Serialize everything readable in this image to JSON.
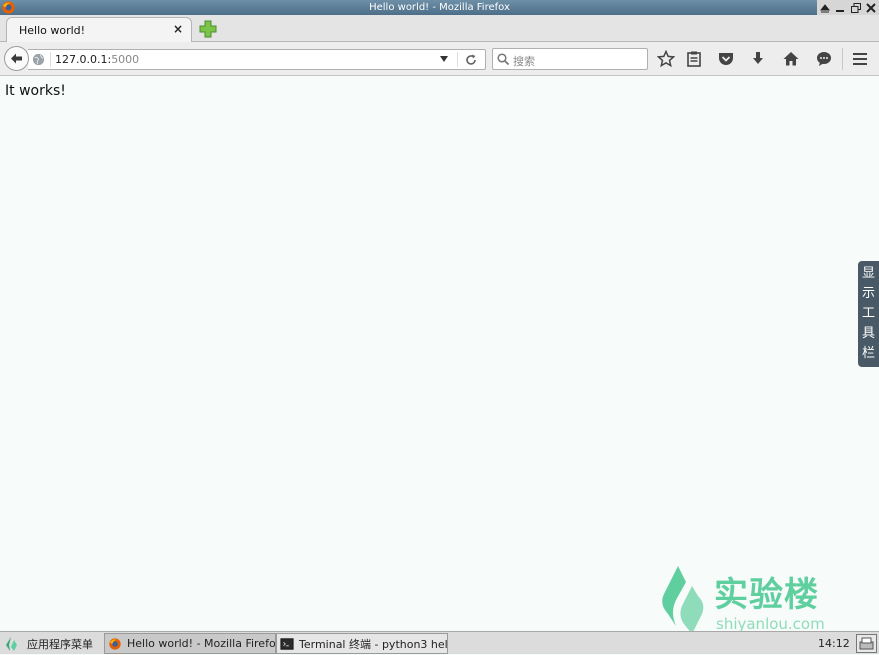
{
  "window": {
    "title": "Hello world! - Mozilla Firefox"
  },
  "tab": {
    "title": "Hello world!",
    "close_glyph": "×"
  },
  "navbar": {
    "url_host": "127.0.0.1:",
    "url_port": "5000",
    "search_placeholder": "搜索"
  },
  "page": {
    "body_text": "It works!"
  },
  "side_toolbar": {
    "chars": [
      "显",
      "示",
      "工",
      "具",
      "栏"
    ]
  },
  "watermark": {
    "text": "实验楼",
    "url": "shiyanlou.com"
  },
  "taskbar": {
    "start_label": "应用程序菜单",
    "tasks": [
      {
        "label": "Hello world! - Mozilla Firefox",
        "icon": "firefox-icon"
      },
      {
        "label": "Terminal 终端 - python3 hel···",
        "icon": "terminal-icon"
      }
    ],
    "clock": "14:12"
  },
  "colors": {
    "accent": "#5fcfa0",
    "titlebar": "#5b7c96",
    "side_toolbar": "#495a66"
  }
}
